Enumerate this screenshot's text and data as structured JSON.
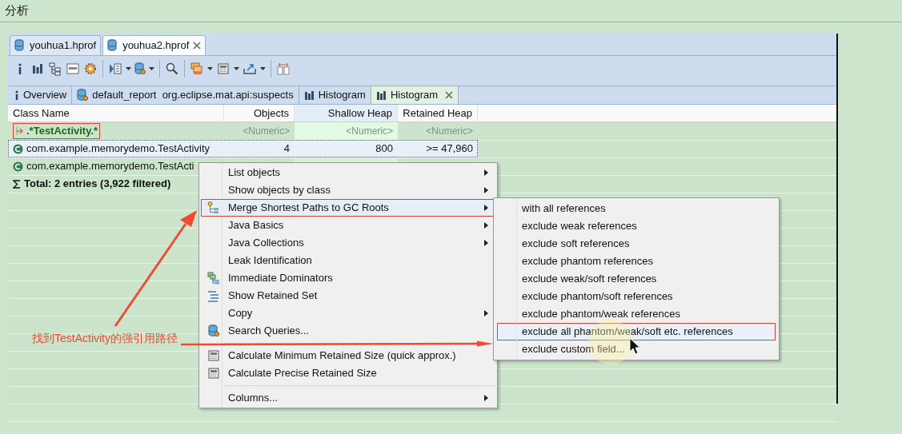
{
  "header": {
    "title": "分析"
  },
  "file_tabs": [
    {
      "label": "youhua1.hprof",
      "selected": false,
      "closable": false
    },
    {
      "label": "youhua2.hprof",
      "selected": true,
      "closable": true
    }
  ],
  "editor_tabs": [
    {
      "kind": "info",
      "label": "Overview",
      "selected": false,
      "closable": false
    },
    {
      "kind": "report",
      "label": "default_report  org.eclipse.mat.api:suspects",
      "selected": false,
      "closable": false
    },
    {
      "kind": "histogram",
      "label": "Histogram",
      "selected": false,
      "closable": false
    },
    {
      "kind": "histogram",
      "label": "Histogram",
      "selected": true,
      "closable": true
    }
  ],
  "table": {
    "columns": [
      {
        "label": "Class Name",
        "sorted": false
      },
      {
        "label": "Objects",
        "sorted": false
      },
      {
        "label": "Shallow Heap",
        "sorted": true
      },
      {
        "label": "Retained Heap",
        "sorted": false
      }
    ],
    "filter_row": {
      "cells": [
        ".*TestActivity.*",
        "<Numeric>",
        "<Numeric>",
        "<Numeric>"
      ]
    },
    "rows": [
      {
        "kind": "class",
        "cells": [
          "com.example.memorydemo.TestActivity",
          "4",
          "800",
          ">= 47,960"
        ],
        "selected": true
      },
      {
        "kind": "class",
        "cells": [
          "com.example.memorydemo.TestActi"
        ],
        "selected": false
      },
      {
        "kind": "total",
        "cells": [
          "Total: 2 entries (3,922 filtered)"
        ],
        "selected": false
      }
    ]
  },
  "context_menu": {
    "groups": [
      [
        {
          "label": "List objects",
          "submenu": true,
          "selected": false
        },
        {
          "label": "Show objects by class",
          "submenu": true,
          "selected": false
        },
        {
          "label": "Merge Shortest Paths to GC Roots",
          "submenu": true,
          "selected": true
        },
        {
          "label": "Java Basics",
          "submenu": true,
          "selected": false
        },
        {
          "label": "Java Collections",
          "submenu": true,
          "selected": false
        },
        {
          "label": "Leak Identification",
          "submenu": false,
          "selected": false
        },
        {
          "label": "Immediate Dominators",
          "submenu": false,
          "selected": false
        },
        {
          "label": "Show Retained Set",
          "submenu": false,
          "selected": false
        },
        {
          "label": "Copy",
          "submenu": true,
          "selected": false
        },
        {
          "label": "Search Queries...",
          "submenu": false,
          "selected": false
        }
      ],
      [
        {
          "label": "Calculate Minimum Retained Size (quick approx.)",
          "submenu": false,
          "selected": false
        },
        {
          "label": "Calculate Precise Retained Size",
          "submenu": false,
          "selected": false
        }
      ],
      [
        {
          "label": "Columns...",
          "submenu": true,
          "selected": false
        }
      ]
    ]
  },
  "submenu": {
    "items": [
      {
        "label": "with all references",
        "selected": false
      },
      {
        "label": "exclude weak references",
        "selected": false
      },
      {
        "label": "exclude soft references",
        "selected": false
      },
      {
        "label": "exclude phantom references",
        "selected": false
      },
      {
        "label": "exclude weak/soft references",
        "selected": false
      },
      {
        "label": "exclude phantom/soft references",
        "selected": false
      },
      {
        "label": "exclude phantom/weak references",
        "selected": false
      },
      {
        "label": "exclude all phantom/weak/soft etc. references",
        "selected": true
      },
      {
        "label": "exclude custom field...",
        "selected": false
      }
    ]
  },
  "annotation": {
    "text": "找到TestActivity的强引用路径"
  }
}
